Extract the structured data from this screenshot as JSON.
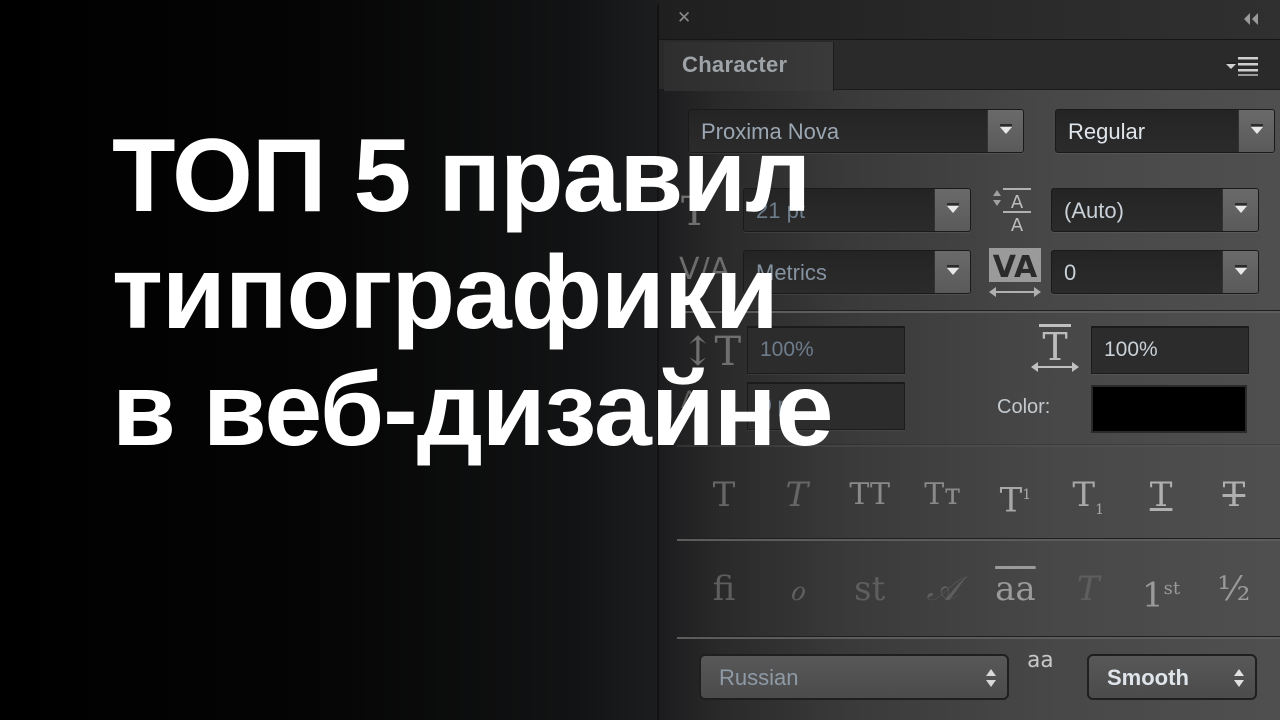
{
  "headline": {
    "lines": [
      "ТОП 5 правил",
      "типографики",
      "в веб-дизайне"
    ]
  },
  "panel": {
    "tab_label": "Character",
    "font_family": "Proxima Nova",
    "font_style": "Regular",
    "font_size": "21 pt",
    "leading": "(Auto)",
    "kerning": "Metrics",
    "tracking": "0",
    "vertical_scale": "100%",
    "horizontal_scale": "100%",
    "baseline_shift": "0 pt",
    "color_label": "Color:",
    "color_value": "#000000",
    "language": "Russian",
    "antialias": "Smooth",
    "antialias_icon_label": "aa",
    "style_buttons": [
      {
        "name": "faux-bold",
        "glyph": "T"
      },
      {
        "name": "faux-italic",
        "glyph": "T"
      },
      {
        "name": "all-caps",
        "glyph": "TT"
      },
      {
        "name": "small-caps",
        "glyph": "Tт"
      },
      {
        "name": "superscript",
        "glyph": "T",
        "mark": "1"
      },
      {
        "name": "subscript",
        "glyph": "T",
        "mark": "1"
      },
      {
        "name": "underline",
        "glyph": "T"
      },
      {
        "name": "strikethrough",
        "glyph": "T"
      }
    ],
    "opentype_buttons": [
      {
        "name": "standard-ligatures",
        "glyph": "ﬁ"
      },
      {
        "name": "contextual-alternates",
        "glyph": "ℴ"
      },
      {
        "name": "discretionary-ligatures",
        "glyph": "st"
      },
      {
        "name": "swash",
        "glyph": "𝒜"
      },
      {
        "name": "stylistic-alternates",
        "glyph": "aa"
      },
      {
        "name": "titling-alternates",
        "glyph": "T"
      },
      {
        "name": "ordinals",
        "glyph": "1",
        "mark": "st"
      },
      {
        "name": "fractions",
        "glyph": "½"
      }
    ]
  }
}
